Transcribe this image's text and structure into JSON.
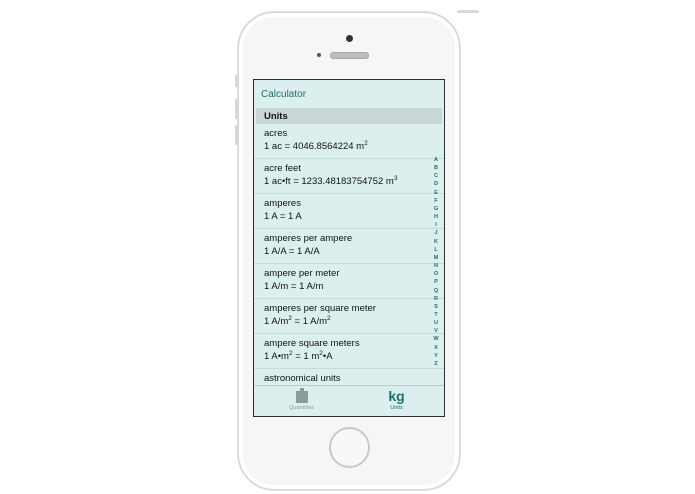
{
  "nav": {
    "title": "Calculator"
  },
  "section": {
    "header": "Units"
  },
  "units": [
    {
      "name": "acres",
      "def": [
        "1 ac = 4046.8564224 m",
        "2",
        ""
      ]
    },
    {
      "name": "acre feet",
      "def": [
        "1 ac•ft = 1233.48183754752 m",
        "3",
        ""
      ]
    },
    {
      "name": "amperes",
      "def": [
        "1 A = 1 A",
        "",
        ""
      ]
    },
    {
      "name": "amperes per ampere",
      "def": [
        "1 A/A = 1 A/A",
        "",
        ""
      ]
    },
    {
      "name": "ampere per meter",
      "def": [
        "1 A/m = 1 A/m",
        "",
        ""
      ]
    },
    {
      "name": "amperes per square meter",
      "def": [
        "1 A/m",
        "2",
        " = 1 A/m",
        "2",
        ""
      ]
    },
    {
      "name": "ampere square meters",
      "def": [
        "1 A•m",
        "2",
        " = 1 m",
        "2",
        "•A"
      ]
    },
    {
      "name": "astronomical units",
      "def": [
        "",
        "",
        ""
      ]
    }
  ],
  "index_letters": [
    "A",
    "B",
    "C",
    "D",
    "E",
    "F",
    "G",
    "H",
    "I",
    "J",
    "K",
    "L",
    "M",
    "N",
    "O",
    "P",
    "Q",
    "R",
    "S",
    "T",
    "U",
    "V",
    "W",
    "X",
    "Y",
    "Z"
  ],
  "tabs": {
    "quantities_label": "Quantities",
    "units_label": "Units",
    "units_icon_text": "kg"
  },
  "colors": {
    "accent": "#1f6f6a",
    "screen_bg": "#dcefef",
    "section_bg": "#c9d6d6",
    "inactive_tab": "#8f9b9b"
  }
}
